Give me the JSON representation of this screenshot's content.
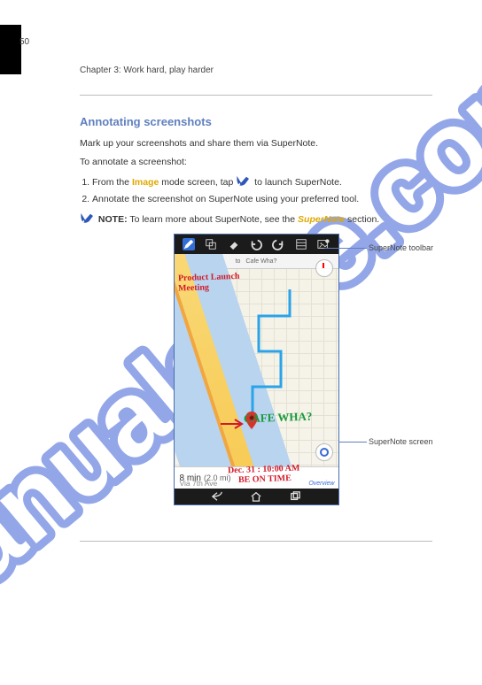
{
  "page_number": "50",
  "chapter_head": "Chapter 3: Work hard, play harder",
  "section_title": "Annotating screenshots",
  "intro": "Mark up your screenshots and share them via SuperNote.",
  "screenshot_steps_label": "To annotate a screenshot:",
  "steps": [
    {
      "text_before": "From the ",
      "yellow": "Image",
      "text_after": " mode screen, tap ",
      "icon": true,
      "tail": " to launch SuperNote."
    },
    {
      "text_before": "Annotate the screenshot on SuperNote using your preferred tool.",
      "yellow": "",
      "text_after": "",
      "icon": false,
      "tail": ""
    }
  ],
  "note_lead": "NOTE:",
  "note_body": "To learn more about SuperNote, see the ",
  "note_link": "SuperNote",
  "note_tail": " section.",
  "labels": {
    "toolbar": "SuperNote toolbar",
    "screen": "SuperNote screen"
  },
  "device": {
    "top_address_left": "to",
    "top_address_right": "Cafe Wha?",
    "route_time": "8 min",
    "route_dist": "(2.0 mi)",
    "route_via": "Via 7th Ave",
    "overview_link": "Overview",
    "handwriting": {
      "top_left_1": "Product Launch",
      "top_left_2": "Meeting",
      "arrow_label": "CAFE WHA?",
      "date_line": "Dec. 31 : 10:00 AM",
      "emph_line": "BE ON TIME"
    }
  }
}
